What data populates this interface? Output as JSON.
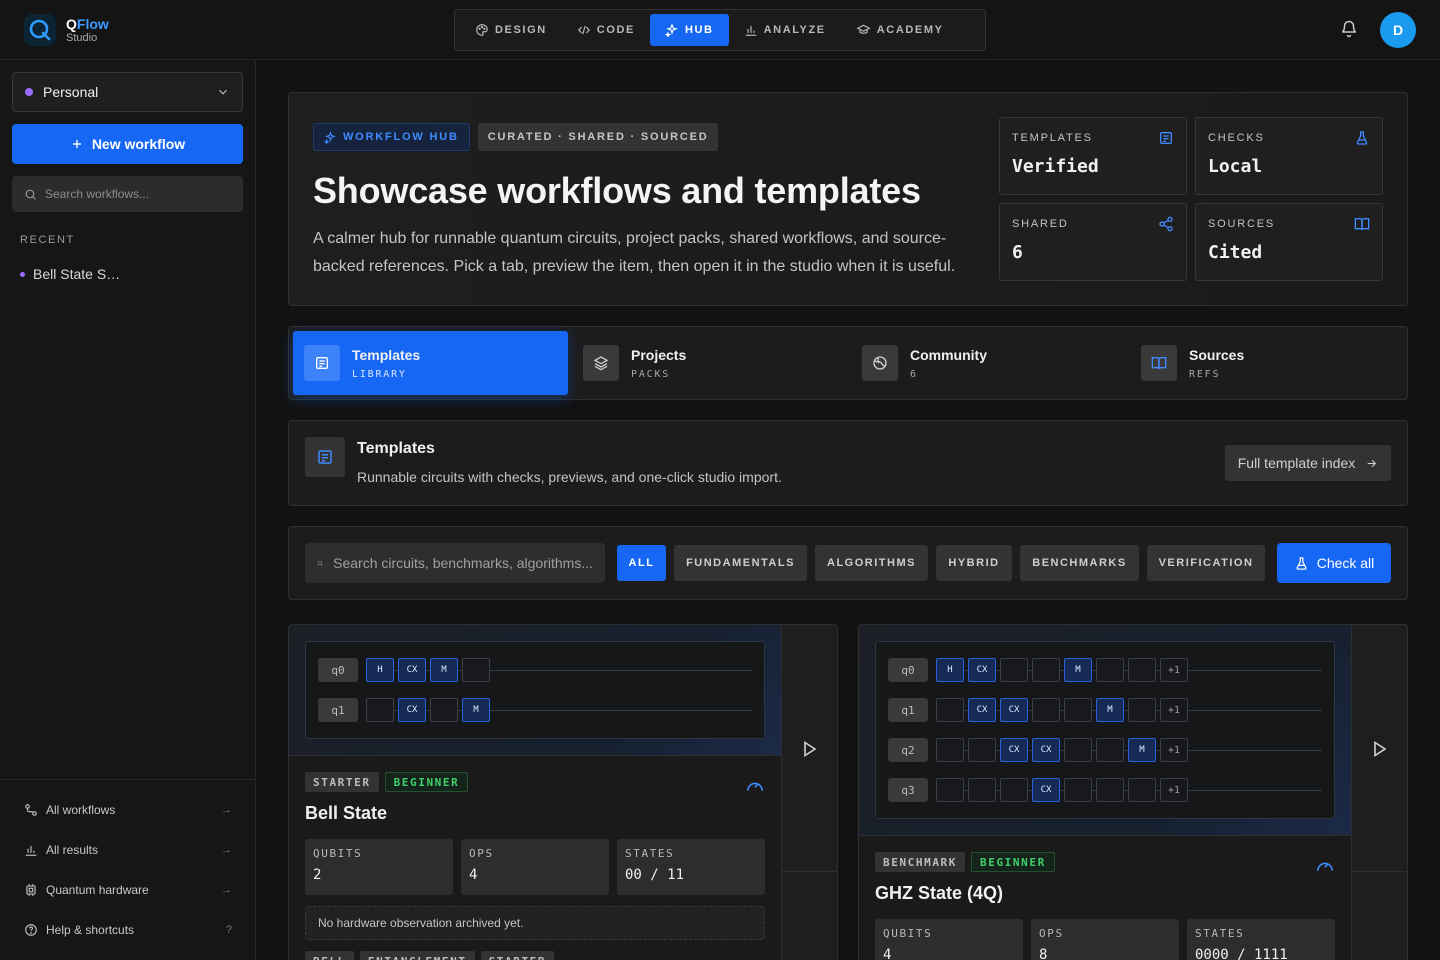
{
  "app": {
    "name_q": "Q",
    "name_rest": "Flow",
    "subtitle": "Studio",
    "avatar": "D"
  },
  "nav": [
    {
      "label": "DESIGN",
      "icon": "palette-icon"
    },
    {
      "label": "CODE",
      "icon": "code-icon"
    },
    {
      "label": "HUB",
      "icon": "sparkles-icon",
      "active": true
    },
    {
      "label": "ANALYZE",
      "icon": "bar-chart-icon"
    },
    {
      "label": "ACADEMY",
      "icon": "graduation-cap-icon"
    }
  ],
  "sidebar": {
    "workspace": "Personal",
    "new_workflow": "New workflow",
    "search_placeholder": "Search workflows...",
    "recent_heading": "RECENT",
    "recent": [
      "Bell State S…"
    ],
    "footer": [
      {
        "label": "All workflows",
        "icon": "workflow-icon",
        "trail": "→"
      },
      {
        "label": "All results",
        "icon": "bar-chart-icon",
        "trail": "→"
      },
      {
        "label": "Quantum hardware",
        "icon": "chip-icon",
        "trail": "→"
      },
      {
        "label": "Help & shortcuts",
        "icon": "help-circle-icon",
        "trail": "?"
      }
    ]
  },
  "hero": {
    "badge": "WORKFLOW HUB",
    "tagline": "CURATED · SHARED · SOURCED",
    "title": "Showcase workflows and templates",
    "description": "A calmer hub for runnable quantum circuits, project packs, shared workflows, and source-backed references. Pick a tab, preview the item, then open it in the studio when it is useful.",
    "stats": [
      {
        "label": "TEMPLATES",
        "value": "Verified",
        "icon": "template-icon"
      },
      {
        "label": "CHECKS",
        "value": "Local",
        "icon": "flask-icon"
      },
      {
        "label": "SHARED",
        "value": "6",
        "icon": "share-icon"
      },
      {
        "label": "SOURCES",
        "value": "Cited",
        "icon": "book-icon"
      }
    ]
  },
  "tabs": [
    {
      "title": "Templates",
      "sub": "LIBRARY",
      "active": true
    },
    {
      "title": "Projects",
      "sub": "PACKS"
    },
    {
      "title": "Community",
      "sub": "6"
    },
    {
      "title": "Sources",
      "sub": "REFS"
    }
  ],
  "section": {
    "title": "Templates",
    "description": "Runnable circuits with checks, previews, and one-click studio import.",
    "button": "Full template index"
  },
  "filters": {
    "search_placeholder": "Search circuits, benchmarks, algorithms...",
    "chips": [
      "ALL",
      "FUNDAMENTALS",
      "ALGORITHMS",
      "HYBRID",
      "BENCHMARKS",
      "VERIFICATION"
    ],
    "active": "ALL",
    "check_all": "Check all"
  },
  "cards": [
    {
      "badges": [
        "STARTER",
        "BEGINNER"
      ],
      "title": "Bell State",
      "metrics": [
        {
          "label": "QUBITS",
          "value": "2"
        },
        {
          "label": "OPS",
          "value": "4"
        },
        {
          "label": "STATES",
          "value": "00 / 11"
        }
      ],
      "note": "No hardware observation archived yet.",
      "tags": [
        "BELL",
        "ENTANGLEMENT",
        "STARTER"
      ],
      "qubits": [
        "q0",
        "q1"
      ],
      "gates": [
        [
          "H",
          "CX",
          "M",
          ""
        ],
        [
          "",
          "CX",
          "",
          "M"
        ]
      ]
    },
    {
      "badges": [
        "BENCHMARK",
        "BEGINNER"
      ],
      "title": "GHZ State (4Q)",
      "metrics": [
        {
          "label": "QUBITS",
          "value": "4"
        },
        {
          "label": "OPS",
          "value": "8"
        },
        {
          "label": "STATES",
          "value": "0000 / 1111"
        }
      ],
      "qubits": [
        "q0",
        "q1",
        "q2",
        "q3"
      ],
      "gates": [
        [
          "H",
          "CX",
          "",
          "",
          "M",
          "",
          "",
          "+1"
        ],
        [
          "",
          "CX",
          "CX",
          "",
          "",
          "M",
          "",
          "+1"
        ],
        [
          "",
          "",
          "CX",
          "CX",
          "",
          "",
          "M",
          "+1"
        ],
        [
          "",
          "",
          "",
          "CX",
          "",
          "",
          "",
          "+1"
        ]
      ]
    }
  ]
}
